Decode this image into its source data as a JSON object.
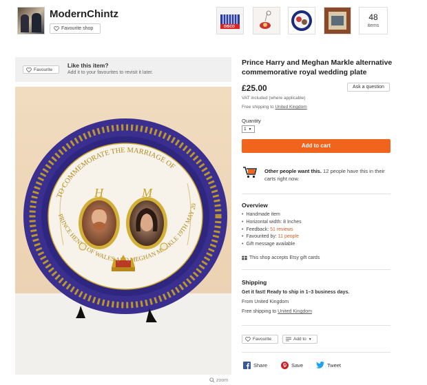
{
  "shop": {
    "name": "ModernChintz",
    "favourite_label": "Favourite shop",
    "items_count": "48",
    "items_label": "items",
    "thumbnails": [
      {
        "name": "disco-thumbnail",
        "text": "DISCO"
      },
      {
        "name": "keyring-thumbnail",
        "text": ""
      },
      {
        "name": "badge-thumbnail",
        "text": ""
      },
      {
        "name": "coaster-thumbnail",
        "text": ""
      }
    ]
  },
  "like_bar": {
    "favourite_label": "Favourite",
    "title": "Like this item?",
    "subtitle": "Add it to your favourites to revisit it later."
  },
  "product": {
    "title": "Prince Harry and Meghan Markle alternative commemorative royal wedding plate",
    "price": "£25.00",
    "ask_label": "Ask a question",
    "vat": "VAT included (where applicable)",
    "free_shipping_prefix": "Free shipping to",
    "free_shipping_country": "United Kingdom",
    "quantity_label": "Quantity",
    "quantity_value": "1",
    "add_to_cart": "Add to cart",
    "others_bold": "Other people want this.",
    "others_text": " 12 people have this in their carts right now.",
    "zoom_label": "zoom"
  },
  "plate_text": {
    "top_arc": "TO COMMEMORATE THE MARRIAGE OF",
    "bottom_arc": "PRINCE HENRY OF WALES AND MEGHAN MARKLE 19TH MAY 2018",
    "left_initial": "H",
    "right_initial": "M"
  },
  "overview": {
    "title": "Overview",
    "items": [
      {
        "text": "Handmade item",
        "accent": ""
      },
      {
        "text": "Horizontal width: 8 Inches",
        "accent": ""
      },
      {
        "text": "Feedback: ",
        "accent": "51 reviews"
      },
      {
        "text": "Favourited by: ",
        "accent": "11 people"
      },
      {
        "text": "Gift message available",
        "accent": ""
      }
    ],
    "gift_cards": "This shop accepts Etsy gift cards"
  },
  "shipping": {
    "title": "Shipping",
    "fast": "Get it fast! Ready to ship in 1–3 business days.",
    "from": "From United Kingdom",
    "free_prefix": "Free shipping to",
    "free_country": "United Kingdom"
  },
  "actions": {
    "favourite_label": "Favourite",
    "add_to_label": "Add to",
    "share_label": "Share",
    "save_label": "Save",
    "tweet_label": "Tweet"
  },
  "colors": {
    "accent_orange": "#f1641e",
    "plate_blue": "#3a2f8f",
    "gold": "#c9a227"
  }
}
